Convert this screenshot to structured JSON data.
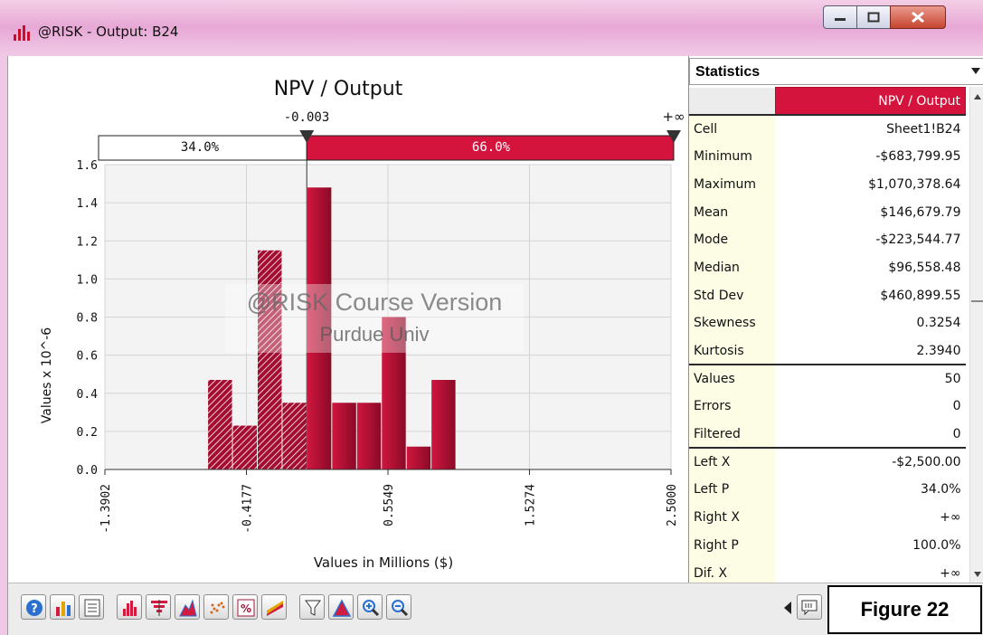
{
  "window": {
    "title": "@RISK - Output: B24"
  },
  "chart_data": {
    "type": "bar",
    "title": "NPV / Output",
    "xlabel": "Values in Millions ($)",
    "ylabel": "Values x 10^-6",
    "xlim": [
      -1.3902,
      2.5
    ],
    "ylim": [
      0,
      1.6
    ],
    "x_ticks": [
      "-1.3902",
      "-0.4177",
      "0.5549",
      "1.5274",
      "2.5000"
    ],
    "y_ticks": [
      "0.0",
      "0.2",
      "0.4",
      "0.6",
      "0.8",
      "1.0",
      "1.2",
      "1.4",
      "1.6"
    ],
    "bin_width": 0.1706,
    "bins": [
      {
        "start": -0.6843,
        "value": 0.47
      },
      {
        "start": -0.5137,
        "value": 0.23
      },
      {
        "start": -0.3431,
        "value": 1.15
      },
      {
        "start": -0.1725,
        "value": 0.35
      },
      {
        "start": -0.0019,
        "value": 1.48
      },
      {
        "start": 0.1687,
        "value": 0.35
      },
      {
        "start": 0.3393,
        "value": 0.35
      },
      {
        "start": 0.5099,
        "value": 0.8
      },
      {
        "start": 0.6805,
        "value": 0.12
      },
      {
        "start": 0.8511,
        "value": 0.47
      }
    ],
    "delimiters": {
      "left_value_label": "-0.003",
      "left_value": -0.003,
      "right_value_label": "+∞",
      "left_pct": "34.0%",
      "right_pct": "66.0%"
    },
    "watermark": {
      "line1": "@RISK Course Version",
      "line2": "Purdue Univ"
    },
    "colors": {
      "bar": "#b30f36",
      "bar_dark": "#7a0a24",
      "accent": "#d4143c"
    },
    "grid": true
  },
  "stats": {
    "header": "Statistics",
    "column": "NPV / Output",
    "rows": [
      {
        "label": "Cell",
        "value": "Sheet1!B24",
        "sep": true
      },
      {
        "label": "Minimum",
        "value": "-$683,799.95"
      },
      {
        "label": "Maximum",
        "value": "$1,070,378.64"
      },
      {
        "label": "Mean",
        "value": "$146,679.79"
      },
      {
        "label": "Mode",
        "value": "-$223,544.77"
      },
      {
        "label": "Median",
        "value": "$96,558.48"
      },
      {
        "label": "Std Dev",
        "value": "$460,899.55"
      },
      {
        "label": "Skewness",
        "value": "0.3254"
      },
      {
        "label": "Kurtosis",
        "value": "2.3940"
      },
      {
        "label": "Values",
        "value": "50",
        "sep": true
      },
      {
        "label": "Errors",
        "value": "0"
      },
      {
        "label": "Filtered",
        "value": "0"
      },
      {
        "label": "Left X",
        "value": "-$2,500.00",
        "sep": true
      },
      {
        "label": "Left P",
        "value": "34.0%"
      },
      {
        "label": "Right X",
        "value": "+∞"
      },
      {
        "label": "Right P",
        "value": "100.0%"
      },
      {
        "label": "Dif. X",
        "value": "+∞"
      }
    ]
  },
  "toolbar": {
    "buttons": [
      {
        "name": "help-button",
        "icon": "help-icon"
      },
      {
        "name": "graph-options-button",
        "icon": "graph-options-icon"
      },
      {
        "name": "report-button",
        "icon": "report-icon"
      },
      {
        "name": "histogram-button",
        "icon": "histogram-icon"
      },
      {
        "name": "tornado-button",
        "icon": "tornado-icon"
      },
      {
        "name": "density-button",
        "icon": "density-icon"
      },
      {
        "name": "scatter-button",
        "icon": "scatter-icon"
      },
      {
        "name": "percent-button",
        "icon": "percent-icon"
      },
      {
        "name": "summary-button",
        "icon": "summary-icon"
      },
      {
        "name": "filter-button",
        "icon": "filter-icon"
      },
      {
        "name": "fit-button",
        "icon": "fit-icon"
      },
      {
        "name": "zoom-in-button",
        "icon": "zoom-in-icon"
      },
      {
        "name": "zoom-out-button",
        "icon": "zoom-out-icon"
      }
    ],
    "figure_label": "Figure 22"
  }
}
